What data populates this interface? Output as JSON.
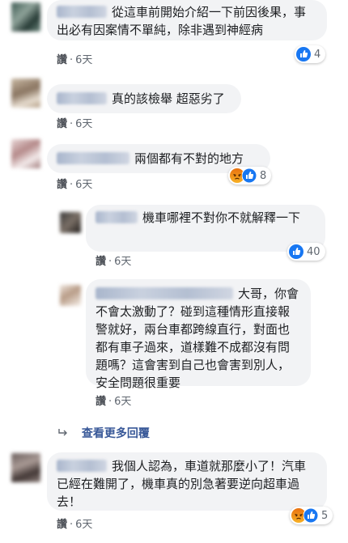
{
  "comments": [
    {
      "text": "從這車前開始介紹一下前因後果，事出必有因案情不單純，除非遇到神經病",
      "like_label": "讚",
      "dot": "·",
      "time": "6天",
      "reaction_count": "4",
      "reactions": [
        "like-icon"
      ]
    },
    {
      "text": "真的該檢舉 超惡劣了",
      "like_label": "讚",
      "dot": "·",
      "time": "6天"
    },
    {
      "text": "兩個都有不對的地方",
      "like_label": "讚",
      "dot": "·",
      "time": "6天",
      "reaction_count": "8",
      "reactions": [
        "angry-icon",
        "like-icon"
      ]
    },
    {
      "text": "機車哪裡不對你不就解釋一下",
      "like_label": "讚",
      "dot": "·",
      "time": "6天",
      "reaction_count": "40",
      "reactions": [
        "like-icon"
      ]
    },
    {
      "text": "大哥，你會不會太激動了？碰到這種情形直接報警就好，兩台車都跨線直行，對面也都有車子過來，道樣難不成都沒有問題嗎？這會害到自己也會害到別人，安全問題很重要",
      "like_label": "讚",
      "dot": "·",
      "time": "6天"
    },
    {
      "text": "我個人認為，車道就那麼小了！汽車已經在難開了，機車真的別急著要逆向超車過去！",
      "like_label": "讚",
      "dot": "·",
      "time": "6天",
      "reaction_count": "5",
      "reactions": [
        "angry-icon",
        "like-icon"
      ]
    }
  ],
  "more_replies": "查看更多回覆",
  "colors": {
    "like_blue": "#1877f2",
    "angry_orange": "#f0662c",
    "link": "#385898"
  }
}
